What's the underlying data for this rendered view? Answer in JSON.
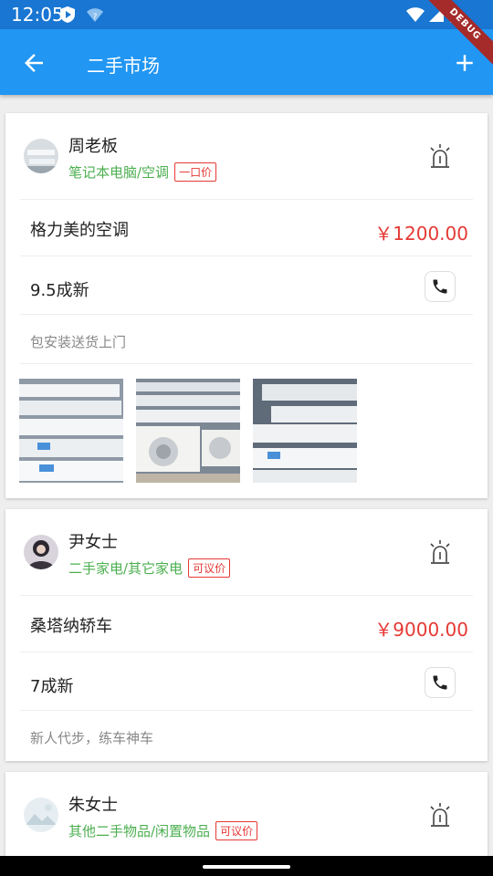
{
  "status_bar": {
    "time": "12:05"
  },
  "app_bar": {
    "title": "二手市场",
    "debug_label": "DEBUG"
  },
  "listings": [
    {
      "seller": "周老板",
      "category": "笔记本电脑/空调",
      "price_type": "一口价",
      "item_title": "格力美的空调",
      "price": "￥1200.00",
      "condition": "9.5成新",
      "description": "包安装送货上门"
    },
    {
      "seller": "尹女士",
      "category": "二手家电/其它家电",
      "price_type": "可议价",
      "item_title": "桑塔纳轿车",
      "price": "￥9000.00",
      "condition": "7成新",
      "description": "新人代步，练车神车"
    },
    {
      "seller": "朱女士",
      "category": "其他二手物品/闲置物品",
      "price_type": "可议价"
    }
  ],
  "colors": {
    "primary": "#2196f3",
    "status_bar": "#1976d2",
    "category": "#4caf50",
    "price": "#e53935"
  }
}
